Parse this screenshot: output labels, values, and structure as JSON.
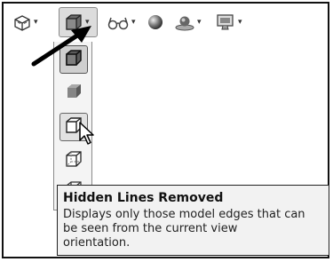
{
  "toolbar": {
    "buttons": [
      {
        "name": "view-orientation",
        "icon": "view-orientation-icon"
      },
      {
        "name": "display-style",
        "icon": "display-style-cube-icon",
        "active": true
      },
      {
        "name": "hide-show-items",
        "icon": "glasses-icon"
      },
      {
        "name": "edit-appearance",
        "icon": "sphere-icon"
      },
      {
        "name": "apply-scene",
        "icon": "scene-icon"
      },
      {
        "name": "view-settings",
        "icon": "monitor-settings-icon"
      }
    ]
  },
  "dropdown": {
    "items": [
      {
        "name": "shaded-with-edges",
        "icon": "shaded-edges-cube-icon"
      },
      {
        "name": "shaded",
        "icon": "shaded-cube-icon"
      },
      {
        "name": "hidden-lines-removed",
        "icon": "hidden-lines-removed-cube-icon",
        "hovered": true
      },
      {
        "name": "hidden-lines-visible",
        "icon": "hidden-lines-visible-cube-icon"
      },
      {
        "name": "wireframe",
        "icon": "wireframe-cube-icon"
      }
    ]
  },
  "tooltip": {
    "title": "Hidden Lines Removed",
    "description_line1": "Displays only those model edges that can",
    "description_line2": "be seen from the current view",
    "description_line3": "orientation."
  },
  "colors": {
    "frame": "#111111",
    "tooltip_bg": "#f2f2f2",
    "dropdown_bg": "#f4f4f4",
    "cube_dark": "#4a4a4a",
    "cube_mid": "#7a7a7a"
  }
}
